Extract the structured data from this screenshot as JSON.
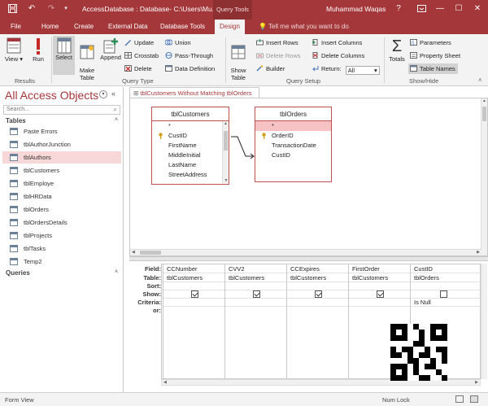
{
  "titlebar": {
    "doc_title": "AccessDatabase : Database- C:\\Users\\Mu...",
    "context_tab": "Query Tools",
    "user": "Muhammad Waqas",
    "help": "?",
    "minimize": "—",
    "restore": "☐",
    "close": "✕"
  },
  "tabs": [
    "File",
    "Home",
    "Create",
    "External Data",
    "Database Tools",
    "Design"
  ],
  "tell_me": "Tell me what you want to do",
  "ribbon": {
    "results": {
      "view": "View",
      "run": "Run",
      "label": "Results"
    },
    "query_type": {
      "select": "Select",
      "make_table": "Make\nTable",
      "append": "Append",
      "update": "Update",
      "crosstab": "Crosstab",
      "delete": "Delete",
      "union": "Union",
      "pass_through": "Pass-Through",
      "data_definition": "Data Definition",
      "label": "Query Type"
    },
    "query_setup": {
      "show_table": "Show\nTable",
      "insert_rows": "Insert Rows",
      "delete_rows": "Delete Rows",
      "builder": "Builder",
      "insert_columns": "Insert Columns",
      "delete_columns": "Delete Columns",
      "return_label": "Return:",
      "return_value": "All",
      "label": "Query Setup"
    },
    "show_hide": {
      "totals": "Totals",
      "parameters": "Parameters",
      "property_sheet": "Property Sheet",
      "table_names": "Table Names",
      "label": "Show/Hide"
    }
  },
  "nav": {
    "title": "All Access Objects",
    "search_placeholder": "Search...",
    "tables_header": "Tables",
    "tables": [
      "Paste Errors",
      "tblAuthorJunction",
      "tblAuthors",
      "tblCustomers",
      "tblEmploye",
      "tblHRData",
      "tblOrders",
      "tblOrdersDetails",
      "tblProjects",
      "tblTasks",
      "Temp2"
    ],
    "queries_header": "Queries"
  },
  "query_tab": "tblCustomers Without Matching tblOrders",
  "tables": {
    "customers": {
      "name": "tblCustomers",
      "fields": [
        "*",
        "CustID",
        "FirstName",
        "MiddleInitial",
        "LastName",
        "StreetAddress"
      ]
    },
    "orders": {
      "name": "tblOrders",
      "fields": [
        "*",
        "OrderID",
        "TransactionDate",
        "CustID"
      ]
    }
  },
  "grid": {
    "row_labels": [
      "Field:",
      "Table:",
      "Sort:",
      "Show:",
      "Criteria:",
      "or:"
    ],
    "columns": [
      {
        "field": "CCNumber",
        "table": "tblCustomers",
        "show": true,
        "criteria": ""
      },
      {
        "field": "CVV2",
        "table": "tblCustomers",
        "show": true,
        "criteria": ""
      },
      {
        "field": "CCExpires",
        "table": "tblCustomers",
        "show": true,
        "criteria": ""
      },
      {
        "field": "FirstOrder",
        "table": "tblCustomers",
        "show": true,
        "criteria": ""
      },
      {
        "field": "CustID",
        "table": "tblOrders",
        "show": false,
        "criteria": "Is Null"
      }
    ]
  },
  "status": {
    "left": "Form View",
    "right": "Num Lock"
  }
}
